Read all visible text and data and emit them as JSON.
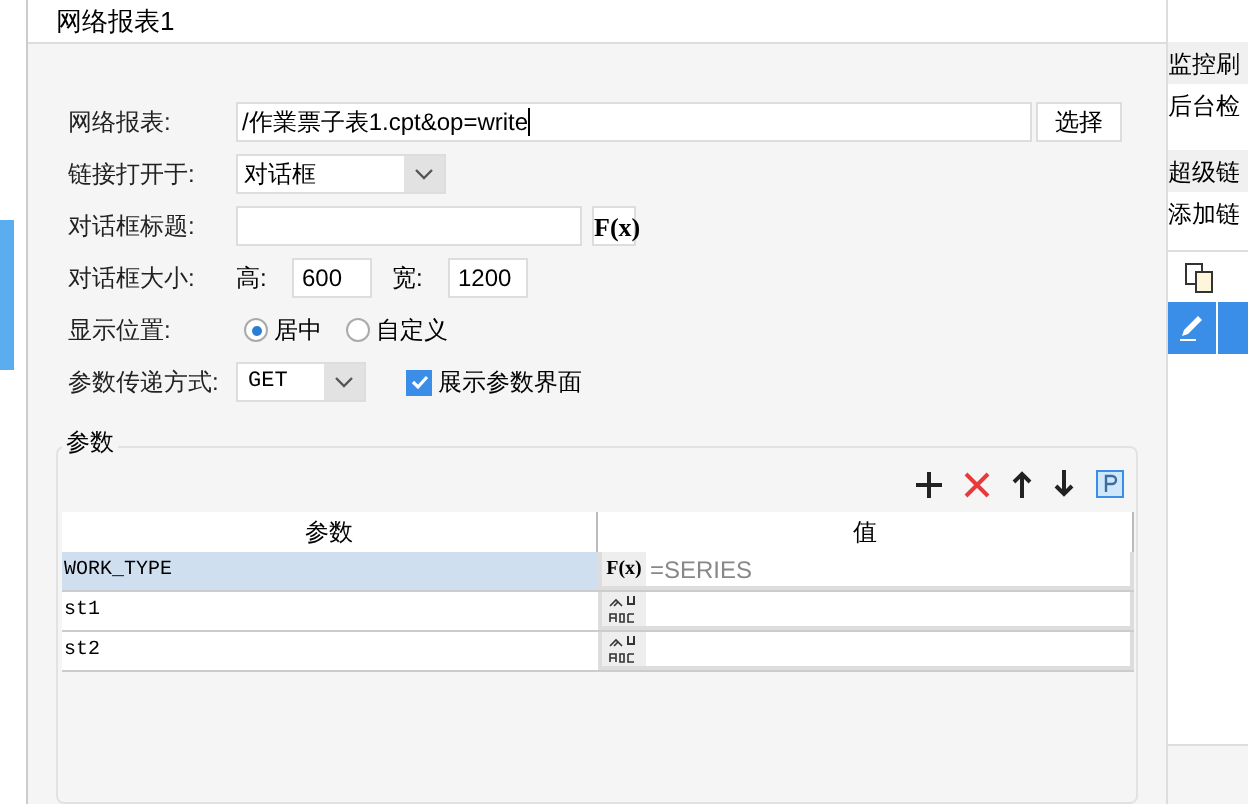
{
  "window": {
    "title": "网络报表1"
  },
  "side_panel": {
    "items": [
      "监控刷",
      "后台检",
      "超级链",
      "添加链"
    ]
  },
  "form": {
    "report_label": "网络报表:",
    "report_value": "/作業票子表1.cpt&op=write",
    "choose_button": "选择",
    "open_in_label": "链接打开于:",
    "open_in_value": "对话框",
    "dialog_title_label": "对话框标题:",
    "formula_button": "F(x)",
    "dialog_size_label": "对话框大小:",
    "height_label": "高:",
    "height_value": "600",
    "width_label": "宽:",
    "width_value": "1200",
    "position_label": "显示位置:",
    "positions": [
      {
        "label": "居中",
        "selected": true
      },
      {
        "label": "自定义",
        "selected": false
      }
    ],
    "method_label": "参数传递方式:",
    "method_value": "GET",
    "show_params": {
      "label": "展示参数界面",
      "checked": true
    }
  },
  "params": {
    "legend": "参数",
    "columns": [
      "参数",
      "值"
    ],
    "rows": [
      {
        "name": "WORK_TYPE",
        "kind": "formula",
        "type_label": "F(x)",
        "value": "=SERIES",
        "selected": true
      },
      {
        "name": "st1",
        "kind": "text",
        "value": "",
        "selected": false
      },
      {
        "name": "st2",
        "kind": "text",
        "value": "",
        "selected": false
      }
    ]
  }
}
